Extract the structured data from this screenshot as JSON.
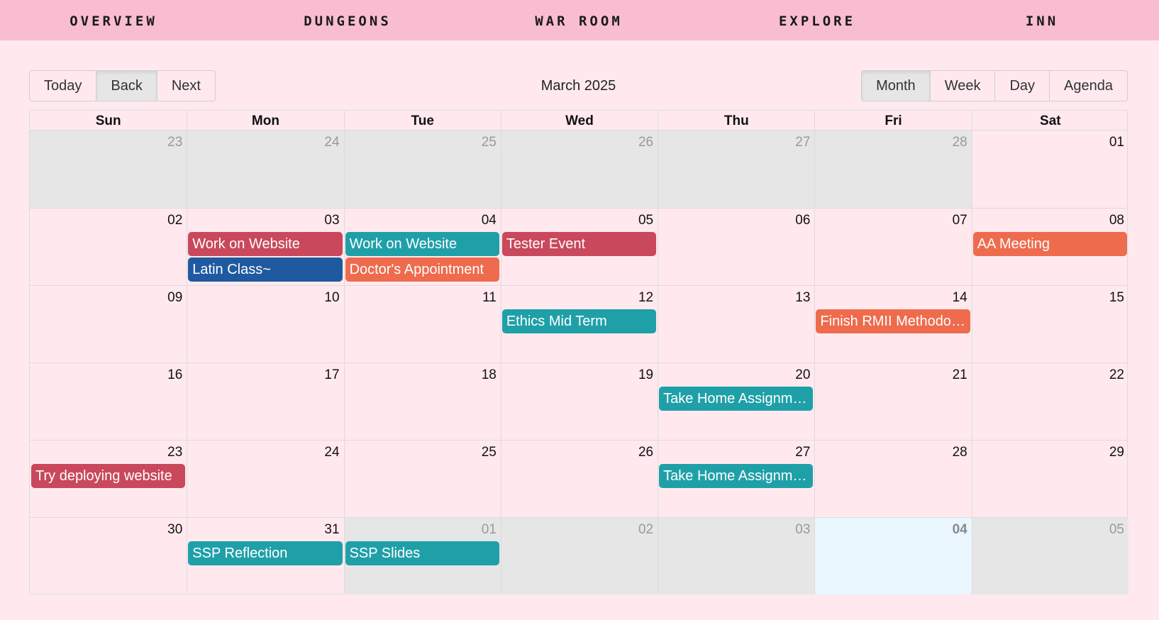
{
  "nav": {
    "items": [
      "OVERVIEW",
      "DUNGEONS",
      "WAR ROOM",
      "EXPLORE",
      "INN"
    ]
  },
  "toolbar": {
    "today_label": "Today",
    "back_label": "Back",
    "next_label": "Next",
    "month_label": "March 2025",
    "views": [
      "Month",
      "Week",
      "Day",
      "Agenda"
    ],
    "active_view": "Month"
  },
  "calendar": {
    "weekdays": [
      "Sun",
      "Mon",
      "Tue",
      "Wed",
      "Thu",
      "Fri",
      "Sat"
    ],
    "weeks": [
      [
        {
          "num": "23",
          "off": true
        },
        {
          "num": "24",
          "off": true
        },
        {
          "num": "25",
          "off": true
        },
        {
          "num": "26",
          "off": true
        },
        {
          "num": "27",
          "off": true
        },
        {
          "num": "28",
          "off": true
        },
        {
          "num": "01"
        }
      ],
      [
        {
          "num": "02"
        },
        {
          "num": "03"
        },
        {
          "num": "04"
        },
        {
          "num": "05"
        },
        {
          "num": "06"
        },
        {
          "num": "07"
        },
        {
          "num": "08"
        }
      ],
      [
        {
          "num": "09"
        },
        {
          "num": "10"
        },
        {
          "num": "11"
        },
        {
          "num": "12"
        },
        {
          "num": "13"
        },
        {
          "num": "14"
        },
        {
          "num": "15"
        }
      ],
      [
        {
          "num": "16"
        },
        {
          "num": "17"
        },
        {
          "num": "18"
        },
        {
          "num": "19"
        },
        {
          "num": "20"
        },
        {
          "num": "21"
        },
        {
          "num": "22"
        }
      ],
      [
        {
          "num": "23"
        },
        {
          "num": "24"
        },
        {
          "num": "25"
        },
        {
          "num": "26"
        },
        {
          "num": "27"
        },
        {
          "num": "28"
        },
        {
          "num": "29"
        }
      ],
      [
        {
          "num": "30"
        },
        {
          "num": "31"
        },
        {
          "num": "01",
          "off": true
        },
        {
          "num": "02",
          "off": true
        },
        {
          "num": "03",
          "off": true
        },
        {
          "num": "04",
          "today": true
        },
        {
          "num": "05",
          "off": true
        }
      ]
    ],
    "events": [
      {
        "week": 1,
        "day": 1,
        "slot": 0,
        "title": "Work on Website",
        "color": "#c9485b"
      },
      {
        "week": 1,
        "day": 1,
        "slot": 1,
        "title": "Latin Class~",
        "color": "#1f5aa0"
      },
      {
        "week": 1,
        "day": 2,
        "slot": 0,
        "title": "Work on Website",
        "color": "#1fa0a8"
      },
      {
        "week": 1,
        "day": 2,
        "slot": 1,
        "title": "Doctor's Appointment",
        "color": "#ee6b4d"
      },
      {
        "week": 1,
        "day": 3,
        "slot": 0,
        "title": "Tester Event",
        "color": "#c9485b"
      },
      {
        "week": 1,
        "day": 6,
        "slot": 0,
        "title": "AA Meeting",
        "color": "#ee6b4d"
      },
      {
        "week": 2,
        "day": 3,
        "slot": 0,
        "title": "Ethics Mid Term",
        "color": "#1fa0a8"
      },
      {
        "week": 2,
        "day": 5,
        "slot": 0,
        "title": "Finish RMII Methodol...",
        "color": "#ee6b4d"
      },
      {
        "week": 3,
        "day": 4,
        "slot": 0,
        "title": "Take Home Assignme...",
        "color": "#1fa0a8"
      },
      {
        "week": 4,
        "day": 0,
        "slot": 0,
        "title": "Try deploying website",
        "color": "#c9485b"
      },
      {
        "week": 4,
        "day": 4,
        "slot": 0,
        "title": "Take Home Assignme...",
        "color": "#1fa0a8"
      },
      {
        "week": 5,
        "day": 1,
        "slot": 0,
        "title": "SSP Reflection",
        "color": "#1fa0a8"
      },
      {
        "week": 5,
        "day": 2,
        "slot": 0,
        "title": "SSP Slides",
        "color": "#1fa0a8"
      }
    ]
  }
}
